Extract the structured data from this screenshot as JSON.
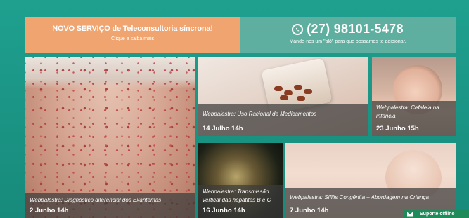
{
  "banner_left": {
    "title": "NOVO SERVIÇO de Teleconsultoria síncrona!",
    "subtitle": "Clique e saiba mais",
    "color": "#f0a570"
  },
  "banner_right": {
    "icon": "whatsapp-icon",
    "phone": "(27) 98101-5478",
    "subtitle": "Mande-nos um \"alô\" para que possamos te adicionar.",
    "color": "#5eaf9f"
  },
  "tiles": [
    {
      "title": "Webpalestra: Diagnóstico diferencial dos Exantemas",
      "date": "2 Junho 14h"
    },
    {
      "title": "Webpalestra: Uso Racional de Medicamentos",
      "date": "14 Julho 14h"
    },
    {
      "title": "Webpalestra: Cefaleia na infância",
      "date": "23 Junho 15h"
    },
    {
      "title": "Webpalestra: Transmissão vertical das hepatites B e C",
      "date": "16 Junho 14h"
    },
    {
      "title": "Webpalestra: Sífilis Congênita – Abordagem na Criança",
      "date": "7 Junho 14h"
    }
  ],
  "support": {
    "label": "Suporte offline",
    "icon": "envelope-icon"
  }
}
